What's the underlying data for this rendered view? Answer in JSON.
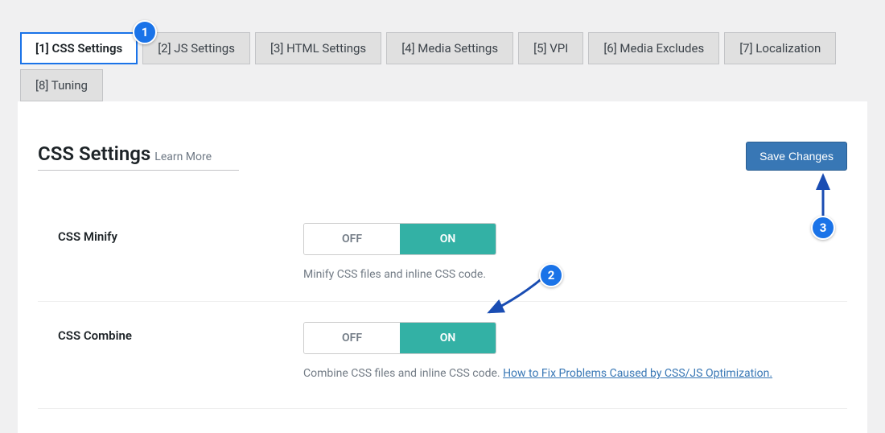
{
  "tabs": [
    {
      "label": "[1] CSS Settings",
      "active": true
    },
    {
      "label": "[2] JS Settings",
      "active": false
    },
    {
      "label": "[3] HTML Settings",
      "active": false
    },
    {
      "label": "[4] Media Settings",
      "active": false
    },
    {
      "label": "[5] VPI",
      "active": false
    },
    {
      "label": "[6] Media Excludes",
      "active": false
    },
    {
      "label": "[7] Localization",
      "active": false
    },
    {
      "label": "[8] Tuning",
      "active": false
    }
  ],
  "page_title": "CSS Settings",
  "learn_more": "Learn More",
  "save_button": "Save Changes",
  "settings": {
    "minify": {
      "label": "CSS Minify",
      "off": "OFF",
      "on": "ON",
      "desc": "Minify CSS files and inline CSS code."
    },
    "combine": {
      "label": "CSS Combine",
      "off": "OFF",
      "on": "ON",
      "desc_prefix": "Combine CSS files and inline CSS code. ",
      "desc_link": "How to Fix Problems Caused by CSS/JS Optimization."
    }
  },
  "annotations": {
    "b1": "1",
    "b2": "2",
    "b3": "3"
  }
}
